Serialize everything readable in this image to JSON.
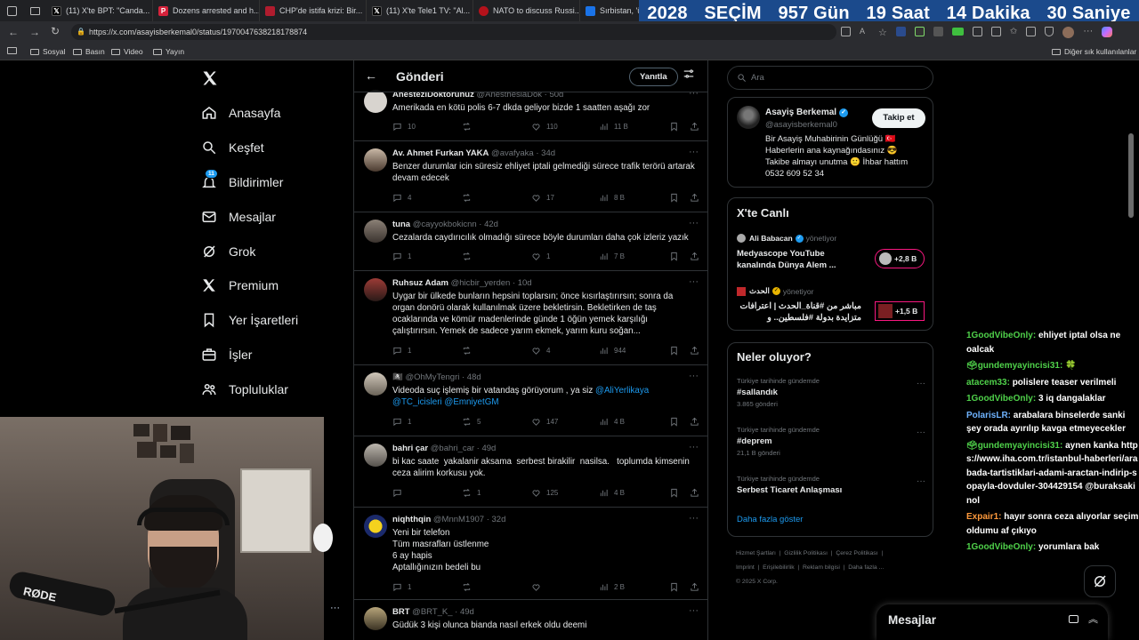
{
  "browser": {
    "tabs": [
      {
        "label": "(11) X'te BPT: \"Canda...",
        "color": "#000000",
        "icon": "x-logo-icon"
      },
      {
        "label": "Dozens arrested and h...",
        "color": "#d6223b",
        "icon": "p-logo-icon"
      },
      {
        "label": "CHP'de istifa krizi: Bir...",
        "color": "#b01c2e",
        "icon": "news-logo-icon"
      },
      {
        "label": "(11) X'te Tele1 TV: \"Al...",
        "color": "#000000",
        "icon": "x-logo-icon"
      },
      {
        "label": "NATO to discuss Russi...",
        "color": "#b4121b",
        "icon": "news-logo-icon"
      },
      {
        "label": "Sırbistan, 'ü...",
        "color": "#1a73e8",
        "icon": "news-logo-icon"
      }
    ],
    "url": "https://x.com/asayisberkemal0/status/1970047638218178874",
    "bookmarks": [
      "Sosyal",
      "Basın",
      "Video",
      "Yayın"
    ],
    "other_bookmarks": "Diğer sık kullanılanlar"
  },
  "countdown": {
    "year": "2028",
    "label": "SEÇİM",
    "days": "957 Gün",
    "hours": "19 Saat",
    "minutes": "14 Dakika",
    "seconds": "30 Saniye"
  },
  "nav": {
    "items": [
      {
        "label": "Anasayfa",
        "icon": "home-icon"
      },
      {
        "label": "Keşfet",
        "icon": "search-icon"
      },
      {
        "label": "Bildirimler",
        "icon": "bell-icon",
        "badge": "11"
      },
      {
        "label": "Mesajlar",
        "icon": "mail-icon"
      },
      {
        "label": "Grok",
        "icon": "grok-icon"
      },
      {
        "label": "Premium",
        "icon": "x-premium-icon"
      },
      {
        "label": "Yer İşaretleri",
        "icon": "bookmark-icon"
      },
      {
        "label": "İşler",
        "icon": "briefcase-icon"
      },
      {
        "label": "Topluluklar",
        "icon": "people-icon"
      }
    ]
  },
  "post_header": {
    "title": "Gönderi",
    "reply_button": "Yanıtla"
  },
  "tweets": [
    {
      "name": "AnesteziDoktorunuz",
      "handle": "@AnesthesiaDok · 50d",
      "text": "Amerikada en kötü polis 6-7 dkda geliyor bizde 1 saatten aşağı zor",
      "replies": "10",
      "retweets": "",
      "likes": "110",
      "views": "11 B"
    },
    {
      "name": "Av. Ahmet Furkan YAKA",
      "handle": "@avafyaka · 34d",
      "text": "Benzer durumlar icin süresiz ehliyet iptali gelmediği sürece trafik terörü artarak devam edecek",
      "replies": "4",
      "retweets": "",
      "likes": "17",
      "views": "8 B"
    },
    {
      "name": "tuna",
      "handle": "@cayyokbokicnn · 42d",
      "text": "Cezalarda caydırıcılık olmadığı sürece böyle durumları daha çok izleriz yazık",
      "replies": "1",
      "retweets": "",
      "likes": "1",
      "views": "7 B"
    },
    {
      "name": "Ruhsuz Adam",
      "handle": "@hicbir_yerden · 10d",
      "text": "Uygar bir ülkede bunların hepsini toplarsın; önce kısırlaştırırsın; sonra da organ donörü olarak kullanılmak üzere bekletirsin. Bekletirken de taş ocaklarında ve kömür madenlerinde günde 1 öğün yemek karşılığı çalıştırırsın. Yemek de sadece yarım ekmek, yarım kuru soğan...",
      "replies": "1",
      "retweets": "",
      "likes": "4",
      "views": "944"
    },
    {
      "name": "🏴‍☠️",
      "handle": "@OhMyTengri · 48d",
      "text": "Videoda suç işlemiş bir vatandaş görüyorum , ya siz",
      "mentions": "@AliYerlikaya @TC_icisleri @EmniyetGM",
      "replies": "1",
      "retweets": "5",
      "likes": "147",
      "views": "4 B"
    },
    {
      "name": "bahri çar",
      "handle": "@bahri_car · 49d",
      "text": "bi kac saate  yakalanir aksama  serbest birakilir  nasilsa.   toplumda kimsenin  ceza alirim korkusu yok.",
      "replies": "",
      "retweets": "1",
      "likes": "125",
      "views": "4 B"
    },
    {
      "name": "niqhthqin",
      "handle": "@MnnM1907 · 32d",
      "text_lines": [
        "Yeni bir telefon",
        "Tüm masrafları üstlenme",
        "6 ay hapis",
        "Aptallığınızın bedeli bu"
      ],
      "replies": "1",
      "retweets": "",
      "likes": "",
      "views": "2 B"
    },
    {
      "name": "BRT",
      "handle": "@BRT_K_ · 49d",
      "text": "Güdük 3 kişi olunca bianda nasıl erkek oldu deemi"
    }
  ],
  "search": {
    "placeholder": "Ara"
  },
  "profile_card": {
    "name": "Asayiş Berkemal",
    "handle": "@asayisberkemal0",
    "follow": "Takip et",
    "bio_lines": [
      "Bir Asayiş Muhabirinin Günlüğü 🇹🇷",
      "Haberlerin ana kaynağındasınız 😎",
      "Takibe almayı unutma 🙂 İhbar hattım",
      "0532 609 52 34"
    ]
  },
  "live": {
    "title": "X'te Canlı",
    "items": [
      {
        "host": "Ali Babacan",
        "status": "yönetiyor",
        "title_lines": [
          "Medyascope YouTube",
          "kanalında Dünya Alem ..."
        ],
        "listeners": "+2,8 B"
      },
      {
        "host": "الحدث",
        "status": "yönetiyor",
        "title_lines": [
          "مباشر من #قناة_الحدث | اعترافات",
          "متزايدة بدولة #فلسطين.. و"
        ],
        "listeners": "+1,5 B"
      }
    ]
  },
  "trends": {
    "title": "Neler oluyor?",
    "items": [
      {
        "context": "Türkiye tarihinde gündemde",
        "name": "#sallandık",
        "count": "3.865 gönderi"
      },
      {
        "context": "Türkiye tarihinde gündemde",
        "name": "#deprem",
        "count": "21,1 B gönderi"
      },
      {
        "context": "Türkiye tarihinde gündemde",
        "name": "Serbest Ticaret Anlaşması",
        "count": ""
      }
    ],
    "more": "Daha fazla göster"
  },
  "footer": {
    "links_row1": [
      "Hizmet Şartları",
      "Gizlilik Politikası",
      "Çerez Politikası"
    ],
    "links_row2": [
      "Imprint",
      "Erişilebilirlik",
      "Reklam bilgisi",
      "Daha fazla ..."
    ],
    "copyright": "© 2025 X Corp."
  },
  "chat": [
    {
      "user": "1GoodVibeOnly:",
      "color": "green",
      "msg": "ehliyet iptal olsa ne oalcak"
    },
    {
      "user": "🗳gundemyayincisi31:",
      "color": "green",
      "msg": "🍀"
    },
    {
      "user": "atacem33:",
      "color": "green",
      "msg": "polislere teaser verilmeli"
    },
    {
      "user": "1GoodVibeOnly:",
      "color": "green",
      "msg": "3 iq dangalaklar"
    },
    {
      "user": "PolarisLR:",
      "color": "blue",
      "msg": "arabalara binselerde sanki şey orada ayırılıp kavga etmeyecekler"
    },
    {
      "user": "🗳gundemyayincisi31:",
      "color": "green",
      "msg": "aynen kanka https://www.iha.com.tr/istanbul-haberleri/arabada-tartistiklari-adami-aractan-indirip-sopayla-dovduler-304429154 @buraksakinol"
    },
    {
      "user": "Expair1:",
      "color": "orange",
      "msg": "hayır sonra ceza alıyorlar seçim oldumu af çıkıyo"
    },
    {
      "user": "1GoodVibeOnly:",
      "color": "green",
      "msg": "yorumlara bak"
    }
  ],
  "messages_dock": {
    "label": "Mesajlar"
  },
  "webcam": {
    "mic_brand": "RØDE"
  }
}
